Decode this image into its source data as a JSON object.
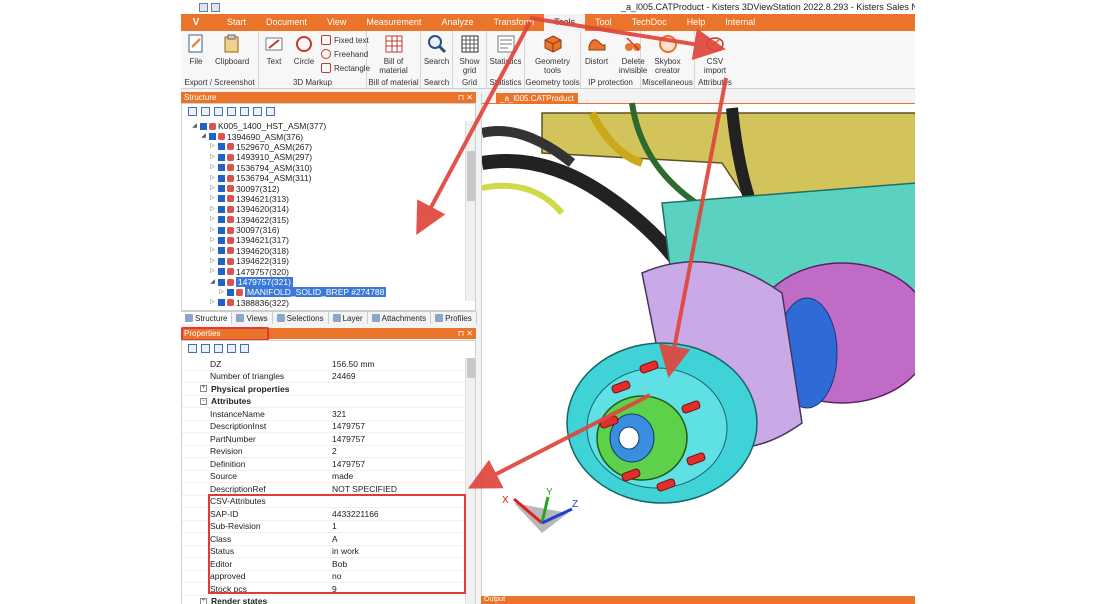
{
  "window_title": "_a_l005.CATProduct - Kisters 3DViewStation 2022.8.293 - Kisters Sales NFR - Sales - NOT",
  "menu": {
    "app_button": "V",
    "tabs": [
      "Start",
      "Document",
      "View",
      "Measurement",
      "Analyze",
      "Transform",
      "Tools",
      "Tool",
      "TechDoc",
      "Help",
      "Internal"
    ],
    "active_tab": "Tools"
  },
  "ribbon": {
    "groups": [
      {
        "label": "Export / Screenshot",
        "buttons": [
          "File",
          "Clipboard"
        ]
      },
      {
        "label": "3D Markup",
        "buttons": [
          "Text",
          "Circle"
        ],
        "small": [
          "Fixed text",
          "Freehand",
          "Rectangle"
        ]
      },
      {
        "label": "Bill of material",
        "buttons": [
          "Bill of material"
        ]
      },
      {
        "label": "Search",
        "buttons": [
          "Search"
        ]
      },
      {
        "label": "Grid",
        "buttons": [
          "Show grid"
        ]
      },
      {
        "label": "Statistics",
        "buttons": [
          "Statistics"
        ]
      },
      {
        "label": "Geometry tools",
        "buttons": [
          "Geometry tools"
        ]
      },
      {
        "label": "IP protection",
        "buttons": [
          "Distort",
          "Delete invisible"
        ]
      },
      {
        "label": "Miscellaneous",
        "buttons": [
          "Skybox creator"
        ]
      },
      {
        "label": "Attributes",
        "buttons": [
          "CSV import"
        ]
      }
    ]
  },
  "structure": {
    "title": "Structure",
    "tree": [
      {
        "label": "K005_1400_HST_ASM(377)",
        "depth": 1,
        "expanded": true
      },
      {
        "label": "1394690_ASM(376)",
        "depth": 2,
        "expanded": true
      },
      {
        "label": "1529670_ASM(267)",
        "depth": 3
      },
      {
        "label": "1493910_ASM(297)",
        "depth": 3
      },
      {
        "label": "1536794_ASM(310)",
        "depth": 3
      },
      {
        "label": "1536794_ASM(311)",
        "depth": 3
      },
      {
        "label": "30097(312)",
        "depth": 3
      },
      {
        "label": "1394621(313)",
        "depth": 3
      },
      {
        "label": "1394620(314)",
        "depth": 3
      },
      {
        "label": "1394622(315)",
        "depth": 3
      },
      {
        "label": "30097(316)",
        "depth": 3
      },
      {
        "label": "1394621(317)",
        "depth": 3
      },
      {
        "label": "1394620(318)",
        "depth": 3
      },
      {
        "label": "1394622(319)",
        "depth": 3
      },
      {
        "label": "1479757(320)",
        "depth": 3
      },
      {
        "label": "1479757(321)",
        "depth": 3,
        "expanded": true,
        "selected": true
      },
      {
        "label": "MANIFOLD_SOLID_BREP #274788",
        "depth": 4,
        "selected": true
      },
      {
        "label": "1388836(322)",
        "depth": 3
      }
    ],
    "tabs": [
      "Structure",
      "Views",
      "Selections",
      "Layer",
      "Attachments",
      "Profiles"
    ]
  },
  "properties": {
    "title": "Properties",
    "rows": [
      {
        "key": "DZ",
        "value": "156.50 mm"
      },
      {
        "key": "Number of triangles",
        "value": "24469"
      },
      {
        "key": "Physical properties",
        "value": "",
        "category": true,
        "collapsed": true
      },
      {
        "key": "Attributes",
        "value": "",
        "category": true
      },
      {
        "key": "InstanceName",
        "value": "321"
      },
      {
        "key": "DescriptionInst",
        "value": "1479757"
      },
      {
        "key": "PartNumber",
        "value": "1479757"
      },
      {
        "key": "Revision",
        "value": "2"
      },
      {
        "key": "Definition",
        "value": "1479757"
      },
      {
        "key": "Source",
        "value": "made"
      },
      {
        "key": "DescriptionRef",
        "value": "NOT SPECIFIED"
      },
      {
        "key": "CSV-Attributes",
        "value": "",
        "csvhead": true
      },
      {
        "key": "SAP-ID",
        "value": "4433221166"
      },
      {
        "key": "Sub-Revision",
        "value": "1"
      },
      {
        "key": "Class",
        "value": "A"
      },
      {
        "key": "Status",
        "value": "in work"
      },
      {
        "key": "Editor",
        "value": "Bob"
      },
      {
        "key": "approved",
        "value": "no"
      },
      {
        "key": "Stock pcs",
        "value": "9"
      },
      {
        "key": "Render states",
        "value": "",
        "category": true,
        "collapsed": true
      }
    ]
  },
  "viewport": {
    "tab_title": "_a_l005.CATProduct",
    "axis_labels": {
      "x": "X",
      "y": "Y",
      "z": "Z"
    }
  },
  "output": {
    "title": "Output"
  },
  "colors": {
    "accent": "#e9742a",
    "highlight_box": "#e03a3a",
    "arrow": "#e0463c",
    "selection": "#3b78d8"
  }
}
